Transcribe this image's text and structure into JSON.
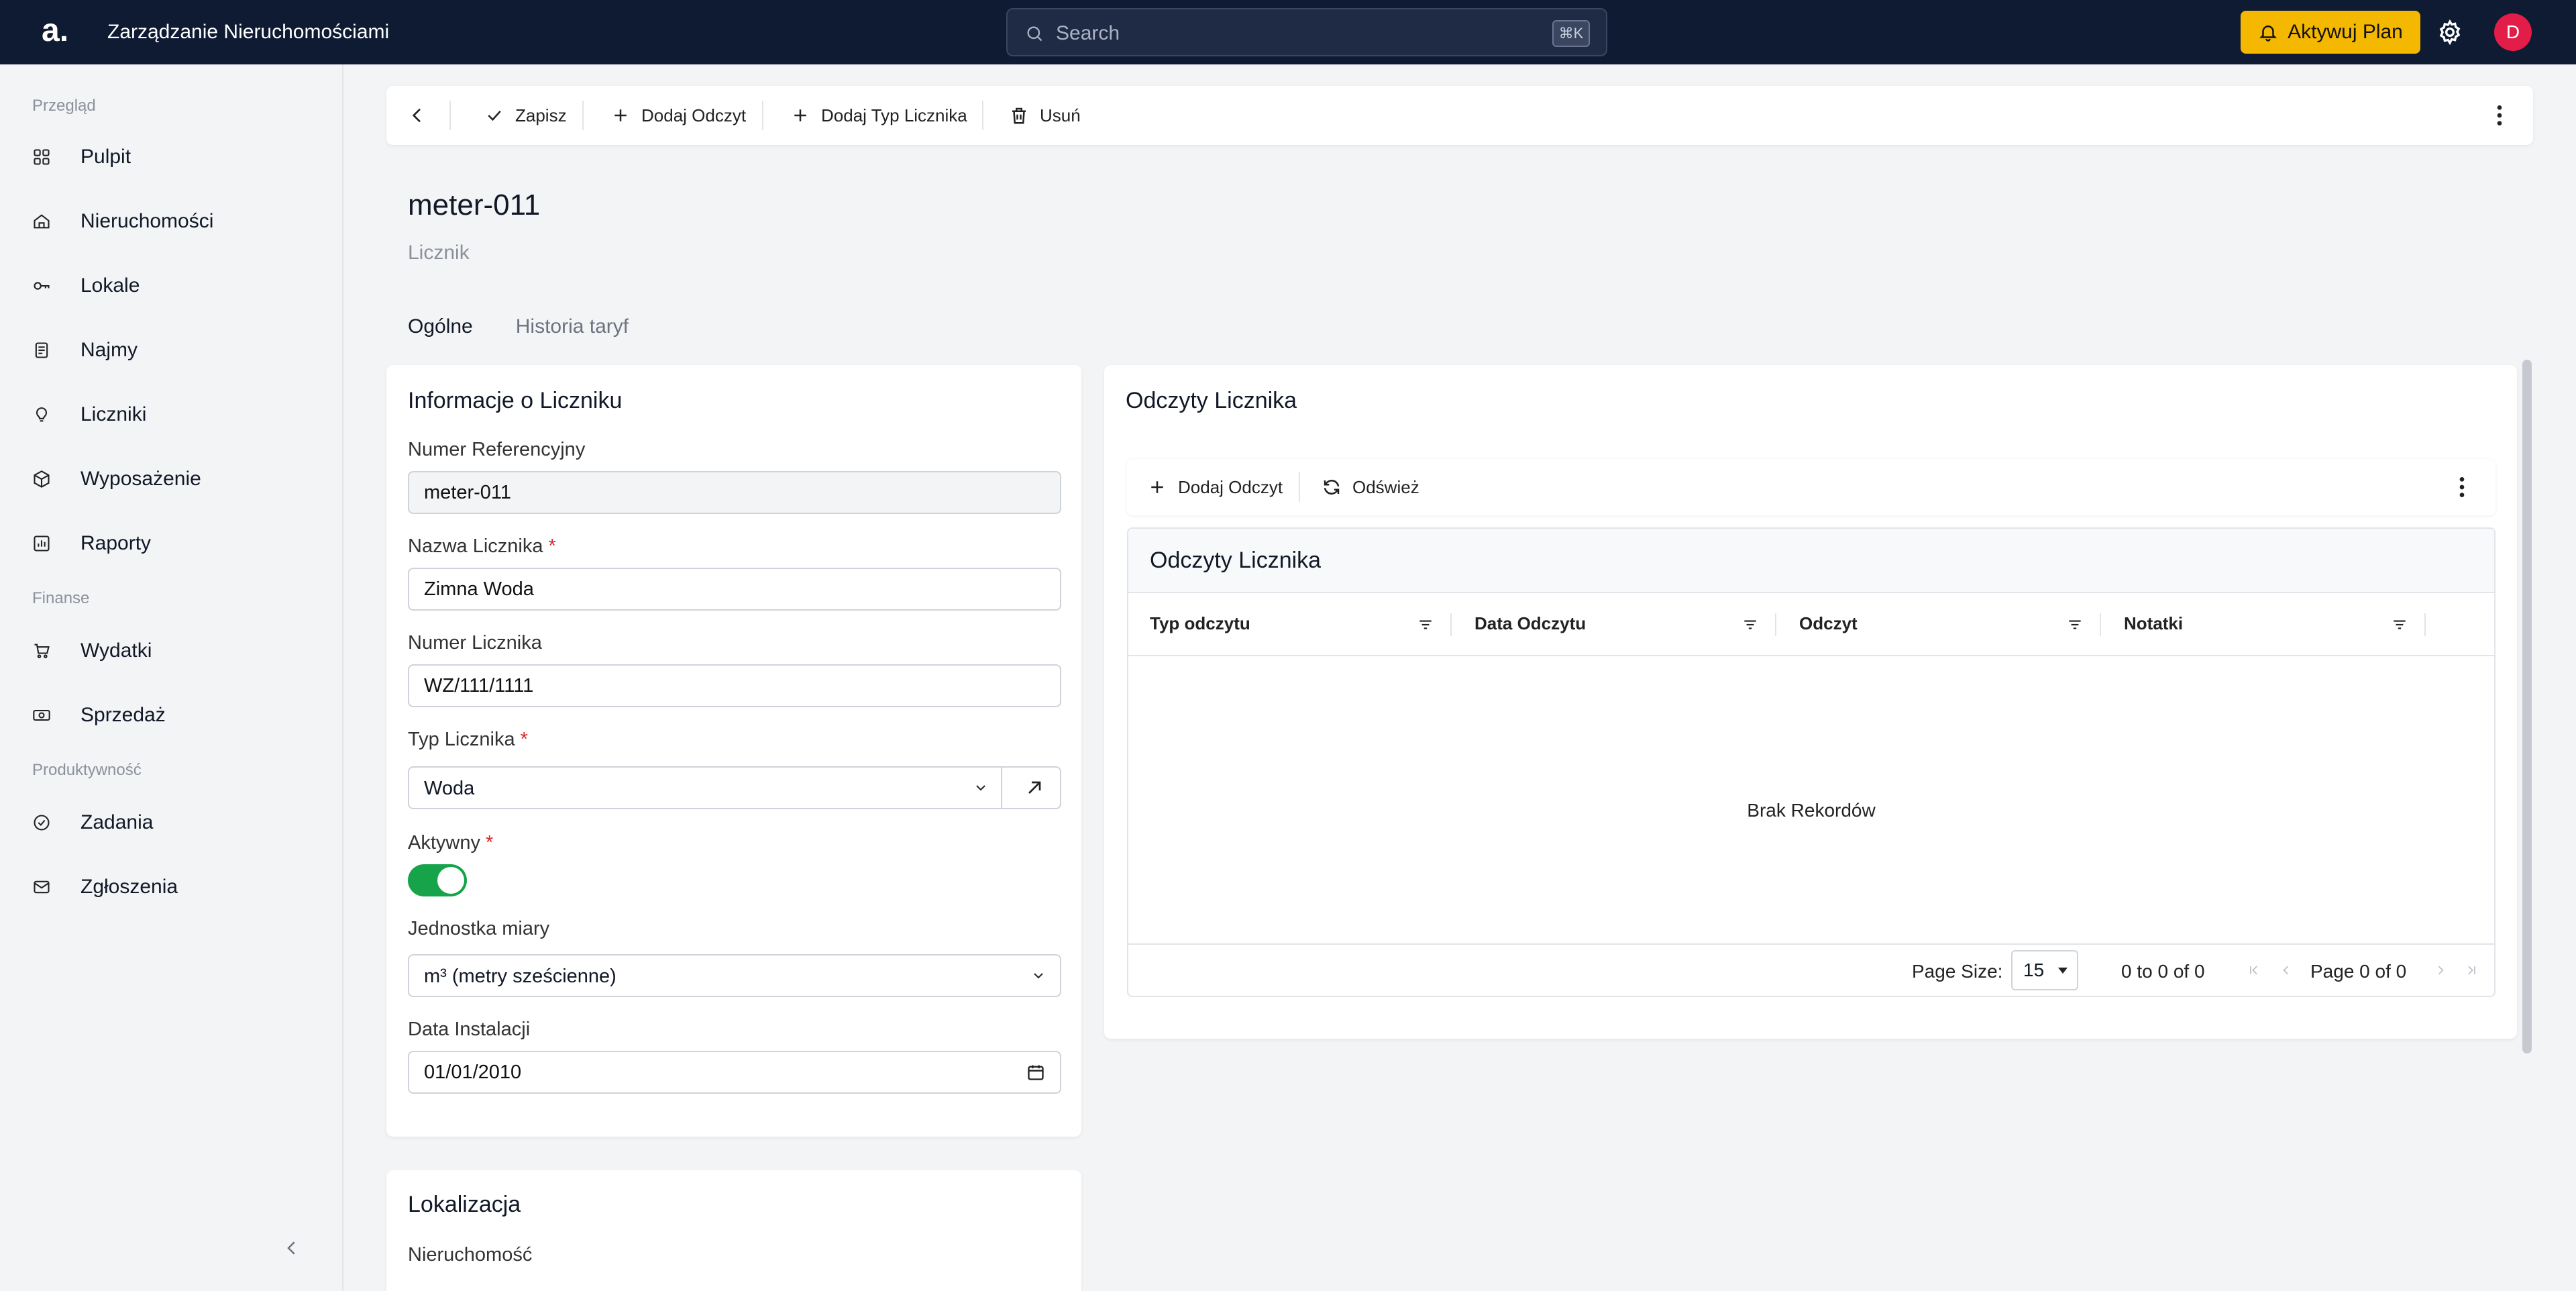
{
  "topbar": {
    "logo": "a.",
    "app_title": "Zarządzanie Nieruchomościami",
    "search_placeholder": "Search",
    "search_shortcut": "⌘K",
    "plan_button": "Aktywuj Plan",
    "avatar_initial": "D",
    "accent_color": "#f5b800"
  },
  "sidebar": {
    "sections": [
      {
        "label": "Przegląd",
        "items": [
          {
            "label": "Pulpit",
            "icon": "dashboard-icon"
          },
          {
            "label": "Nieruchomości",
            "icon": "home-icon"
          },
          {
            "label": "Lokale",
            "icon": "key-icon"
          },
          {
            "label": "Najmy",
            "icon": "document-icon"
          },
          {
            "label": "Liczniki",
            "icon": "lightbulb-icon"
          },
          {
            "label": "Wyposażenie",
            "icon": "box-icon"
          },
          {
            "label": "Raporty",
            "icon": "chart-icon"
          }
        ]
      },
      {
        "label": "Finanse",
        "items": [
          {
            "label": "Wydatki",
            "icon": "cart-icon"
          },
          {
            "label": "Sprzedaż",
            "icon": "cash-icon"
          }
        ]
      },
      {
        "label": "Produktywność",
        "items": [
          {
            "label": "Zadania",
            "icon": "check-circle-icon"
          },
          {
            "label": "Zgłoszenia",
            "icon": "mail-icon"
          }
        ]
      }
    ]
  },
  "toolbar": {
    "save": "Zapisz",
    "add_reading": "Dodaj Odczyt",
    "add_meter_type": "Dodaj Typ Licznika",
    "delete": "Usuń"
  },
  "page": {
    "title": "meter-011",
    "subtitle": "Licznik",
    "tabs": [
      {
        "label": "Ogólne",
        "active": true
      },
      {
        "label": "Historia taryf",
        "active": false
      }
    ]
  },
  "meter_info": {
    "title": "Informacje o Liczniku",
    "ref_label": "Numer Referencyjny",
    "ref_value": "meter-011",
    "name_label": "Nazwa Licznika",
    "name_value": "Zimna Woda",
    "number_label": "Numer Licznika",
    "number_value": "WZ/111/1111",
    "type_label": "Typ Licznika",
    "type_value": "Woda",
    "active_label": "Aktywny",
    "active_value": true,
    "unit_label": "Jednostka miary",
    "unit_value": "m³ (metry sześcienne)",
    "install_label": "Data Instalacji",
    "install_value": "01/01/2010",
    "required_mark": "*"
  },
  "location": {
    "title": "Lokalizacja",
    "property_label": "Nieruchomość"
  },
  "readings": {
    "title": "Odczyty Licznika",
    "add_button": "Dodaj Odczyt",
    "refresh_button": "Odśwież",
    "grid_title": "Odczyty Licznika",
    "columns": [
      "Typ odczytu",
      "Data Odczytu",
      "Odczyt",
      "Notatki"
    ],
    "empty_text": "Brak Rekordów",
    "page_size_label": "Page Size:",
    "page_size_value": "15",
    "range_text": "0 to 0 of 0",
    "page_text": "Page 0 of 0"
  }
}
